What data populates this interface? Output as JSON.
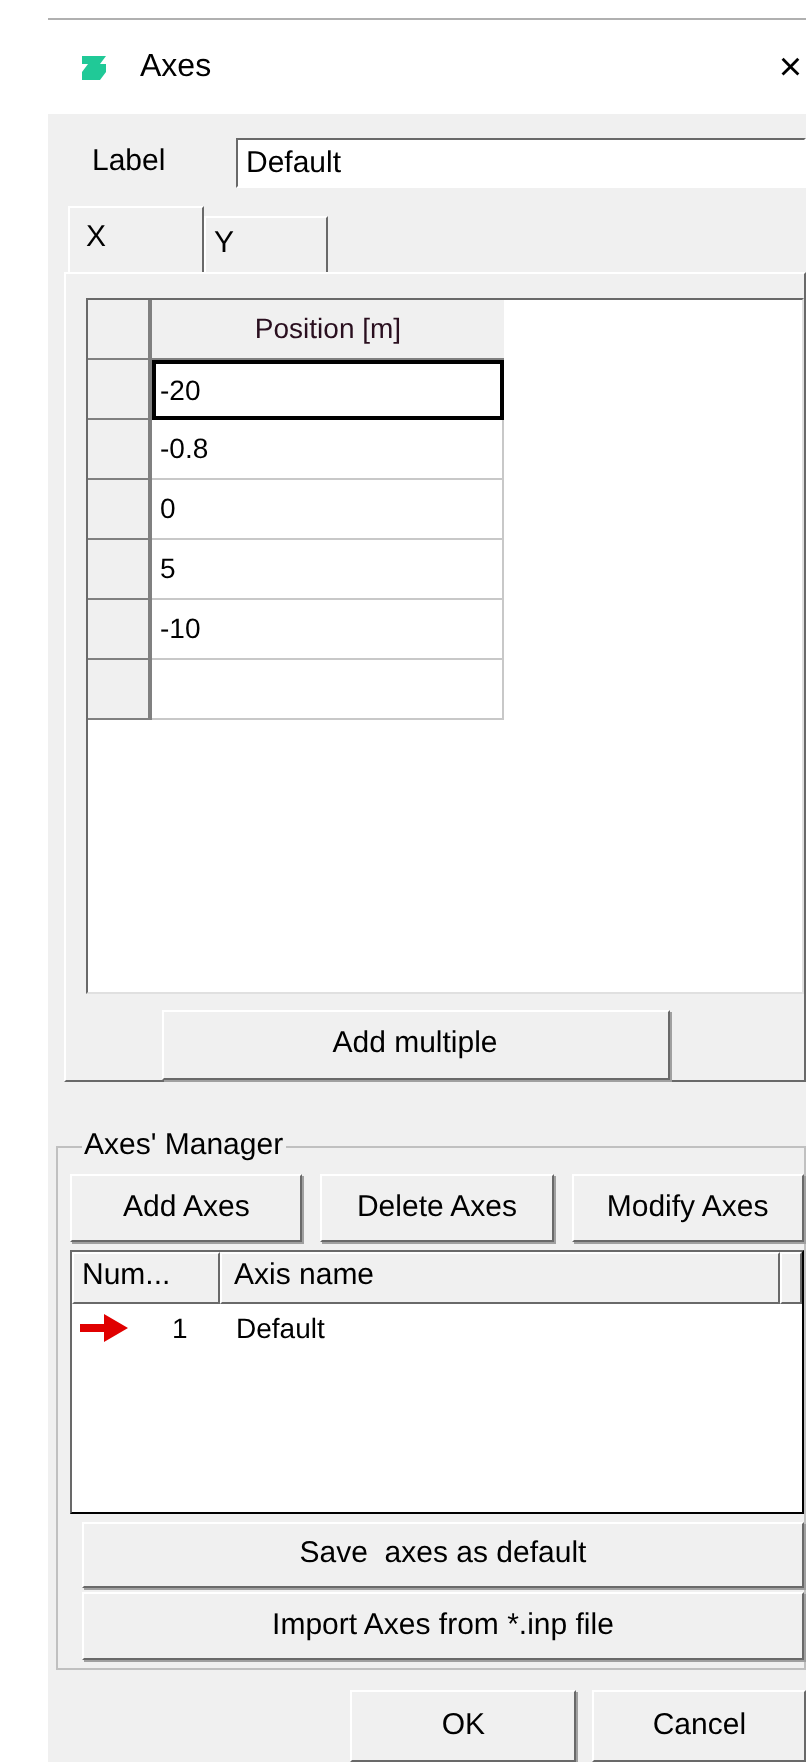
{
  "window": {
    "title": "Axes",
    "close": "×"
  },
  "label_field": {
    "label": "Label",
    "value": "Default"
  },
  "tabs": [
    {
      "label": "X",
      "selected": true
    },
    {
      "label": "Y",
      "selected": false
    }
  ],
  "grid": {
    "columns": [
      "Position [m]"
    ],
    "rows": [
      {
        "value": "-20",
        "selected": true
      },
      {
        "value": "-0.8",
        "selected": false
      },
      {
        "value": "0",
        "selected": false
      },
      {
        "value": "5",
        "selected": false
      },
      {
        "value": "-10",
        "selected": false
      },
      {
        "value": "",
        "selected": false
      }
    ]
  },
  "add_multiple_button": "Add multiple",
  "manager": {
    "title": "Axes' Manager",
    "buttons": [
      "Add Axes",
      "Delete Axes",
      "Modify Axes"
    ],
    "list": {
      "columns": [
        "Num...",
        "Axis name"
      ],
      "rows": [
        {
          "number": "1",
          "name": "Default",
          "current": true
        }
      ]
    },
    "save_button": "Save  axes as default",
    "import_button": "Import Axes from *.inp file"
  },
  "footer_buttons": [
    "OK",
    "Cancel"
  ]
}
